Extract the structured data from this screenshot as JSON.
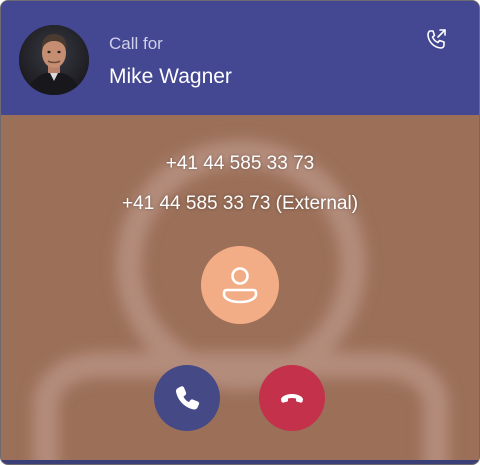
{
  "header": {
    "call_for_label": "Call for",
    "caller_name": "Mike Wagner",
    "avatar_icon": "person-photo-icon",
    "transfer_icon": "phone-forward-icon",
    "background_color": "#444791"
  },
  "call": {
    "number_primary": "+41 44 585 33 73",
    "number_secondary": "+41 44 585 33 73 (External)",
    "contact_icon": "person-icon",
    "contact_color": "#f2ad87"
  },
  "actions": {
    "accept_icon": "phone-icon",
    "accept_color": "#454a87",
    "decline_icon": "hang-up-icon",
    "decline_color": "#c4314b"
  }
}
